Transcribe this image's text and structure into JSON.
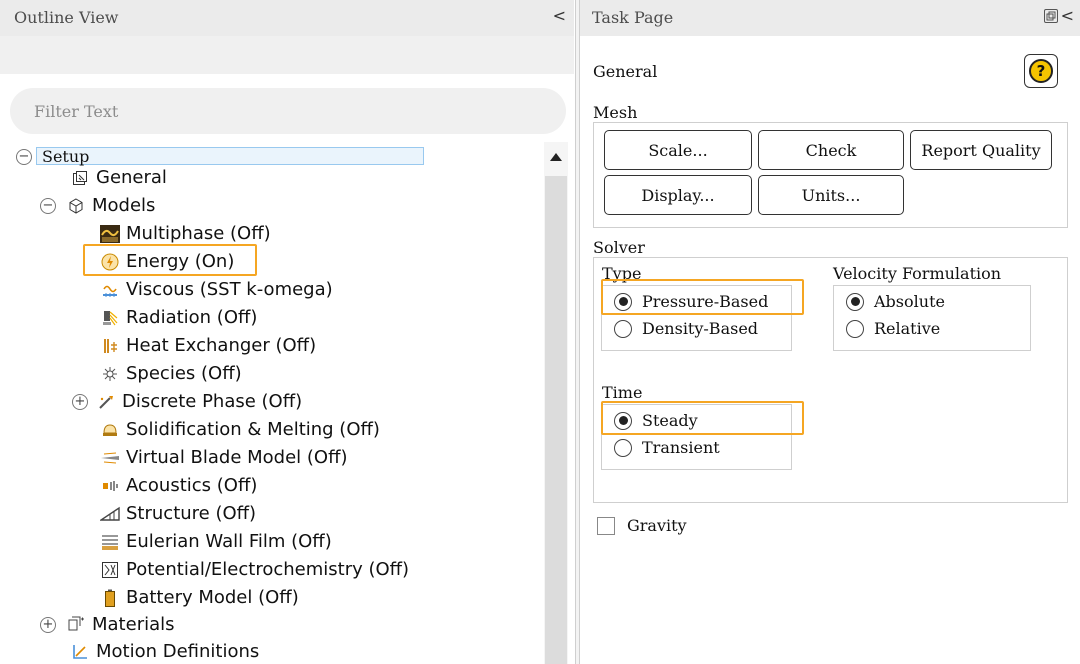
{
  "outline": {
    "title": "Outline View",
    "collapse_glyph": "<",
    "filter_placeholder": "Filter Text",
    "tree": {
      "setup": "Setup",
      "general": "General",
      "models": "Models",
      "multiphase": "Multiphase (Off)",
      "energy": "Energy (On)",
      "viscous": "Viscous (SST k-omega)",
      "radiation": "Radiation (Off)",
      "heat_exchanger": "Heat Exchanger (Off)",
      "species": "Species (Off)",
      "discrete_phase": "Discrete Phase (Off)",
      "solidification": "Solidification & Melting (Off)",
      "virtual_blade": "Virtual Blade Model (Off)",
      "acoustics": "Acoustics (Off)",
      "structure": "Structure (Off)",
      "eulerian_wall_film": "Eulerian Wall Film (Off)",
      "potential": "Potential/Electrochemistry (Off)",
      "battery": "Battery Model (Off)",
      "materials": "Materials",
      "motion_definitions": "Motion Definitions"
    },
    "expander_minus": "−",
    "expander_plus": "+"
  },
  "task": {
    "title": "Task Page",
    "collapse_glyph": "<",
    "heading": "General",
    "help_glyph": "?",
    "mesh": {
      "label": "Mesh",
      "scale": "Scale...",
      "check": "Check",
      "report_quality": "Report Quality",
      "display": "Display...",
      "units": "Units..."
    },
    "solver": {
      "label": "Solver",
      "type_label": "Type",
      "type_options": [
        "Pressure-Based",
        "Density-Based"
      ],
      "type_selected": "Pressure-Based",
      "velocity_label": "Velocity Formulation",
      "velocity_options": [
        "Absolute",
        "Relative"
      ],
      "velocity_selected": "Absolute",
      "time_label": "Time",
      "time_options": [
        "Steady",
        "Transient"
      ],
      "time_selected": "Steady"
    },
    "gravity": {
      "label": "Gravity",
      "checked": false
    }
  },
  "colors": {
    "highlight": "#f5a623",
    "selection": "#99c9ef",
    "help": "#f5c400"
  }
}
